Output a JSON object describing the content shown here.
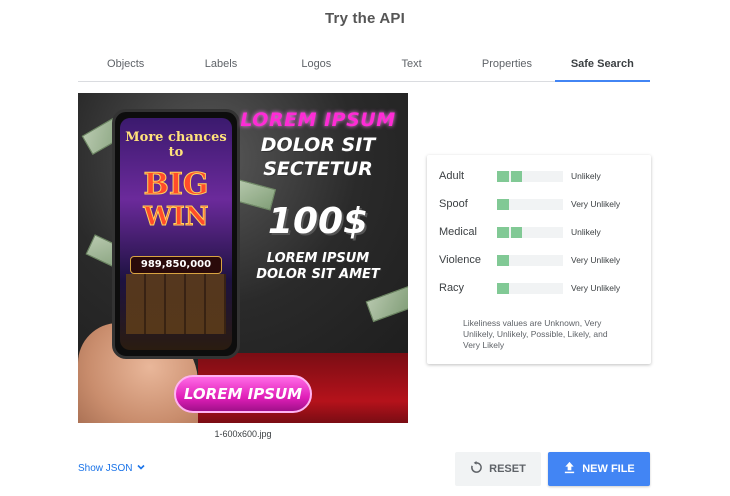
{
  "header": {
    "title": "Try the API"
  },
  "tabs": [
    {
      "label": "Objects",
      "active": false
    },
    {
      "label": "Labels",
      "active": false
    },
    {
      "label": "Logos",
      "active": false
    },
    {
      "label": "Text",
      "active": false
    },
    {
      "label": "Properties",
      "active": false
    },
    {
      "label": "Safe Search",
      "active": true
    }
  ],
  "image": {
    "filename": "1-600x600.jpg",
    "phone": {
      "line1": "More chances",
      "line2": "to",
      "line3": "BIG",
      "line4": "WIN",
      "amount": "989,850,000"
    },
    "promo": {
      "line1": "LOREM IPSUM",
      "line2": "DOLOR SIT",
      "line3": "SECTETUR",
      "price": "100$",
      "line4": "LOREM IPSUM",
      "line5": "DOLOR SIT AMET",
      "button": "LOREM IPSUM"
    }
  },
  "safe_search": {
    "accent_color": "#81c995",
    "rows": [
      {
        "label": "Adult",
        "level": 2,
        "max_level": 5,
        "value": "Unlikely"
      },
      {
        "label": "Spoof",
        "level": 1,
        "max_level": 5,
        "value": "Very Unlikely"
      },
      {
        "label": "Medical",
        "level": 2,
        "max_level": 5,
        "value": "Unlikely"
      },
      {
        "label": "Violence",
        "level": 1,
        "max_level": 5,
        "value": "Very Unlikely"
      },
      {
        "label": "Racy",
        "level": 1,
        "max_level": 5,
        "value": "Very Unlikely"
      }
    ],
    "note": "Likeliness values are Unknown, Very Unlikely, Unlikely, Possible, Likely, and Very Likely"
  },
  "controls": {
    "show_json": "Show JSON",
    "reset": "RESET",
    "new_file": "NEW FILE"
  },
  "colors": {
    "primary": "#4285f4",
    "link": "#1a73e8"
  }
}
